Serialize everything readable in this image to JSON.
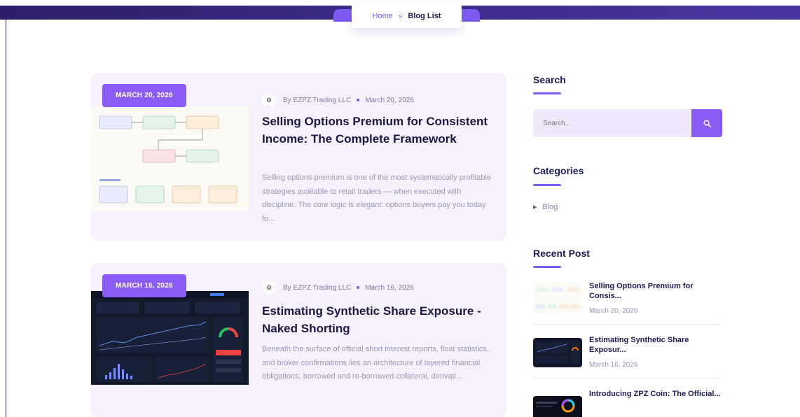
{
  "breadcrumb": {
    "home": "Home",
    "separator": "»",
    "current": "Blog List"
  },
  "posts": [
    {
      "date_badge": "MARCH 20, 2026",
      "author": "By EZPZ Trading LLC",
      "date": "March 20, 2026",
      "title": "Selling Options Premium for Consistent Income: The Complete Framework",
      "excerpt": "Selling options premium is one of the most systematically profitable strategies available to retail traders — when executed with discipline. The core logic is elegant: options buyers pay you today fo..."
    },
    {
      "date_badge": "MARCH 16, 2026",
      "author": "By EZPZ Trading LLC",
      "date": "March 16, 2026",
      "title": "Estimating Synthetic Share Exposure -Naked Shorting",
      "excerpt": "Beneath the surface of official short interest reports, float statistics, and broker confirmations lies an architecture of layered financial obligations, borrowed and re-borrowed collateral, derivati..."
    }
  ],
  "sidebar": {
    "search_heading": "Search",
    "search_placeholder": "Search..",
    "categories_heading": "Categories",
    "categories": [
      "Blog"
    ],
    "recent_heading": "Recent Post",
    "recent": [
      {
        "title": "Selling Options Premium for Consis...",
        "date": "March 20, 2026"
      },
      {
        "title": "Estimating Synthetic Share Exposur...",
        "date": "March 16, 2026"
      },
      {
        "title": "Introducing ZPZ Coin: The Official...",
        "date": ""
      }
    ]
  },
  "colors": {
    "accent": "#8a5cf5",
    "header": "#2e1e6b",
    "card_bg": "#f6f1fc",
    "title": "#1b1846"
  }
}
